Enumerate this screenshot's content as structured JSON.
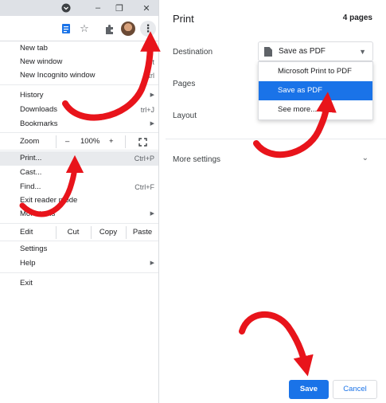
{
  "browser": {
    "window_controls": {
      "minimize": "–",
      "maximize": "❐",
      "close": "✕"
    },
    "menu": {
      "new_tab": {
        "label": "New tab",
        "shortcut": "Ct"
      },
      "new_window": {
        "label": "New window",
        "shortcut": "Ct"
      },
      "new_incognito": {
        "label": "New Incognito window",
        "shortcut": "Ctrl"
      },
      "history": {
        "label": "History"
      },
      "downloads": {
        "label": "Downloads",
        "shortcut": "trl+J"
      },
      "bookmarks": {
        "label": "Bookmarks"
      },
      "zoom": {
        "label": "Zoom",
        "minus": "–",
        "value": "100%",
        "plus": "+"
      },
      "print": {
        "label": "Print...",
        "shortcut": "Ctrl+P"
      },
      "cast": {
        "label": "Cast..."
      },
      "find": {
        "label": "Find...",
        "shortcut": "Ctrl+F"
      },
      "exit_reader": {
        "label": "Exit reader mode"
      },
      "more_tools": {
        "label": "More tools"
      },
      "edit": {
        "label": "Edit",
        "cut": "Cut",
        "copy": "Copy",
        "paste": "Paste"
      },
      "settings": {
        "label": "Settings"
      },
      "help": {
        "label": "Help"
      },
      "exit": {
        "label": "Exit"
      }
    }
  },
  "print_dialog": {
    "title": "Print",
    "page_count": "4 pages",
    "destination_label": "Destination",
    "destination_value": "Save as PDF",
    "destination_options": [
      "Microsoft Print to PDF",
      "Save as PDF",
      "See more..."
    ],
    "selected_option": "Save as PDF",
    "pages_label": "Pages",
    "layout_label": "Layout",
    "more_settings_label": "More settings",
    "save_label": "Save",
    "cancel_label": "Cancel"
  },
  "colors": {
    "accent": "#1a73e8",
    "annotation_arrow": "#e8141b"
  }
}
